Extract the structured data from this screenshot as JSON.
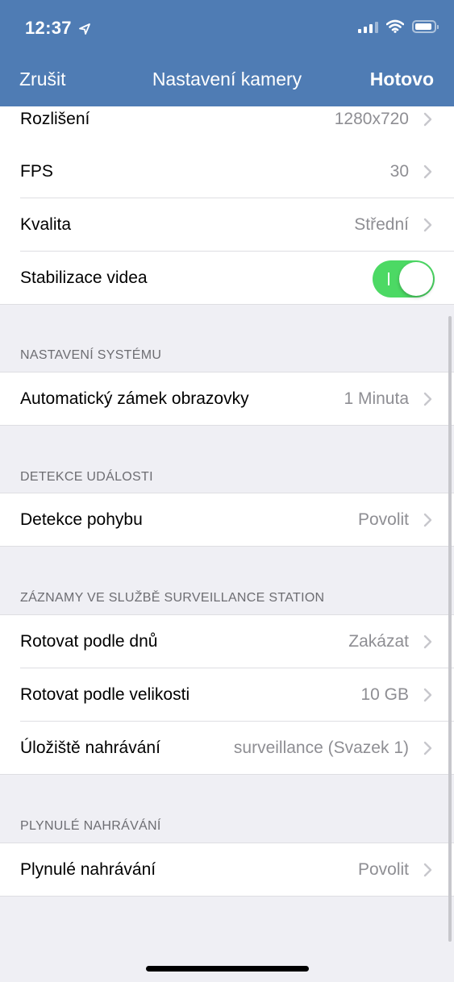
{
  "status_bar": {
    "time": "12:37"
  },
  "nav": {
    "cancel_label": "Zrušit",
    "title": "Nastavení kamery",
    "done_label": "Hotovo"
  },
  "colors": {
    "nav_bg": "#4f7cb4",
    "toggle_on": "#4cd964",
    "value_text": "#8e8e93",
    "group_bg": "#efeff4"
  },
  "video": {
    "resolution": {
      "label": "Rozlišení",
      "value": "1280x720"
    },
    "fps": {
      "label": "FPS",
      "value": "30"
    },
    "quality": {
      "label": "Kvalita",
      "value": "Střední"
    },
    "stabilization": {
      "label": "Stabilizace videa",
      "enabled": true
    }
  },
  "system": {
    "header": "NASTAVENÍ SYSTÉMU",
    "auto_lock": {
      "label": "Automatický zámek obrazovky",
      "value": "1 Minuta"
    }
  },
  "events": {
    "header": "DETEKCE UDÁLOSTI",
    "motion": {
      "label": "Detekce pohybu",
      "value": "Povolit"
    }
  },
  "recordings": {
    "header": "ZÁZNAMY VE SLUŽBĚ SURVEILLANCE STATION",
    "rotate_days": {
      "label": "Rotovat podle dnů",
      "value": "Zakázat"
    },
    "rotate_size": {
      "label": "Rotovat podle velikosti",
      "value": "10 GB"
    },
    "storage": {
      "label": "Úložiště nahrávání",
      "value": "surveillance (Svazek 1)"
    }
  },
  "continuous": {
    "header": "PLYNULÉ NAHRÁVÁNÍ",
    "item": {
      "label": "Plynulé nahrávání",
      "value": "Povolit"
    }
  }
}
